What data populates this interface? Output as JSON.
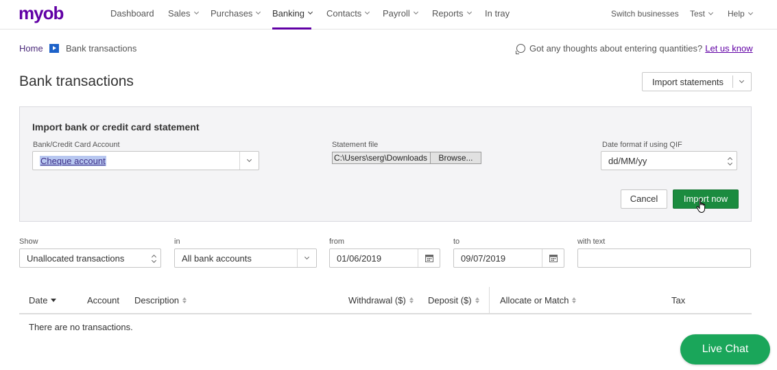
{
  "brand": {
    "logo": "myob"
  },
  "nav": {
    "items": [
      {
        "label": "Dashboard",
        "dropdown": false
      },
      {
        "label": "Sales",
        "dropdown": true
      },
      {
        "label": "Purchases",
        "dropdown": true
      },
      {
        "label": "Banking",
        "dropdown": true,
        "active": true
      },
      {
        "label": "Contacts",
        "dropdown": true
      },
      {
        "label": "Payroll",
        "dropdown": true
      },
      {
        "label": "Reports",
        "dropdown": true
      },
      {
        "label": "In tray",
        "dropdown": false
      }
    ],
    "right": {
      "switch": "Switch businesses",
      "user": "Test",
      "help": "Help"
    }
  },
  "breadcrumb": {
    "home": "Home",
    "current": "Bank transactions"
  },
  "feedback": {
    "text": "Got any thoughts about entering quantities?",
    "link": "Let us know"
  },
  "page": {
    "title": "Bank transactions",
    "import_statements": "Import statements"
  },
  "import_panel": {
    "title": "Import bank or credit card statement",
    "account_label": "Bank/Credit Card Account",
    "account_value": "Cheque account",
    "file_label": "Statement file",
    "file_path": "C:\\Users\\serg\\Downloads",
    "browse": "Browse...",
    "date_format_label": "Date format if using QIF",
    "date_format_value": "dd/MM/yy",
    "cancel": "Cancel",
    "import_now": "Import now"
  },
  "filters": {
    "show_label": "Show",
    "show_value": "Unallocated transactions",
    "in_label": "in",
    "in_value": "All bank accounts",
    "from_label": "from",
    "from_value": "01/06/2019",
    "to_label": "to",
    "to_value": "09/07/2019",
    "text_label": "with text",
    "text_value": ""
  },
  "table": {
    "columns": {
      "date": "Date",
      "account": "Account",
      "description": "Description",
      "withdrawal": "Withdrawal ($)",
      "deposit": "Deposit ($)",
      "allocate": "Allocate or Match",
      "tax": "Tax"
    },
    "empty": "There are no transactions."
  },
  "live_chat": "Live Chat",
  "colors": {
    "brand": "#6100a5",
    "primary_button": "#1b8b3f",
    "chat": "#1aa65a"
  }
}
